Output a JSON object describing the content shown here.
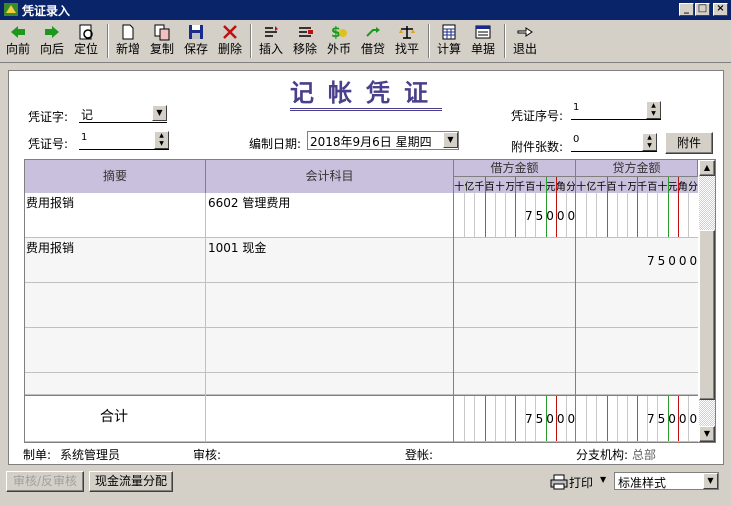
{
  "window": {
    "title": "凭证录入",
    "min": "_",
    "max": "□",
    "close": "×"
  },
  "toolbar": [
    {
      "label": "向前",
      "icon": "arrow-left-icon"
    },
    {
      "label": "向后",
      "icon": "arrow-right-icon"
    },
    {
      "label": "定位",
      "icon": "locate-icon"
    },
    {
      "label": "新增",
      "icon": "new-doc-icon"
    },
    {
      "label": "复制",
      "icon": "copy-icon"
    },
    {
      "label": "保存",
      "icon": "save-icon"
    },
    {
      "label": "删除",
      "icon": "delete-icon"
    },
    {
      "label": "插入",
      "icon": "insert-icon"
    },
    {
      "label": "移除",
      "icon": "remove-icon"
    },
    {
      "label": "外币",
      "icon": "currency-icon"
    },
    {
      "label": "借贷",
      "icon": "debit-credit-icon"
    },
    {
      "label": "找平",
      "icon": "balance-icon"
    },
    {
      "label": "计算",
      "icon": "calculator-icon"
    },
    {
      "label": "单据",
      "icon": "document-icon"
    },
    {
      "label": "退出",
      "icon": "exit-icon"
    }
  ],
  "voucher": {
    "title": "记帐凭证",
    "type_label": "凭证字:",
    "type_value": "记",
    "no_label": "凭证号:",
    "no_value": "1",
    "date_label": "编制日期:",
    "date_value": "2018年9月6日 星期四",
    "seq_label": "凭证序号:",
    "seq_value": "1",
    "attach_label": "附件张数:",
    "attach_value": "0",
    "attach_button": "附件"
  },
  "grid": {
    "col_summary": "摘要",
    "col_account": "会计科目",
    "col_debit": "借方金额",
    "col_credit": "贷方金额",
    "digit_units": [
      "十",
      "亿",
      "千",
      "百",
      "十",
      "万",
      "千",
      "百",
      "十",
      "元",
      "角",
      "分"
    ],
    "rows": [
      {
        "summary": "费用报销",
        "account": "6602 管理费用",
        "debit": "75000",
        "credit": ""
      },
      {
        "summary": "费用报销",
        "account": "1001 现金",
        "debit": "",
        "credit": "75000"
      },
      {
        "summary": "",
        "account": "",
        "debit": "",
        "credit": ""
      },
      {
        "summary": "",
        "account": "",
        "debit": "",
        "credit": ""
      }
    ],
    "total_label": "合计",
    "total_debit": "75000",
    "total_credit": "75000"
  },
  "footer": {
    "maker_label": "制单:",
    "maker_value": "系统管理员",
    "audit_label": "审核:",
    "post_label": "登帐:",
    "branch_label": "分支机构:",
    "branch_value": "总部"
  },
  "status": {
    "audit_button": "审核/反审核",
    "cashflow_button": "现金流量分配",
    "print_label": "打印",
    "style_value": "标准样式"
  }
}
